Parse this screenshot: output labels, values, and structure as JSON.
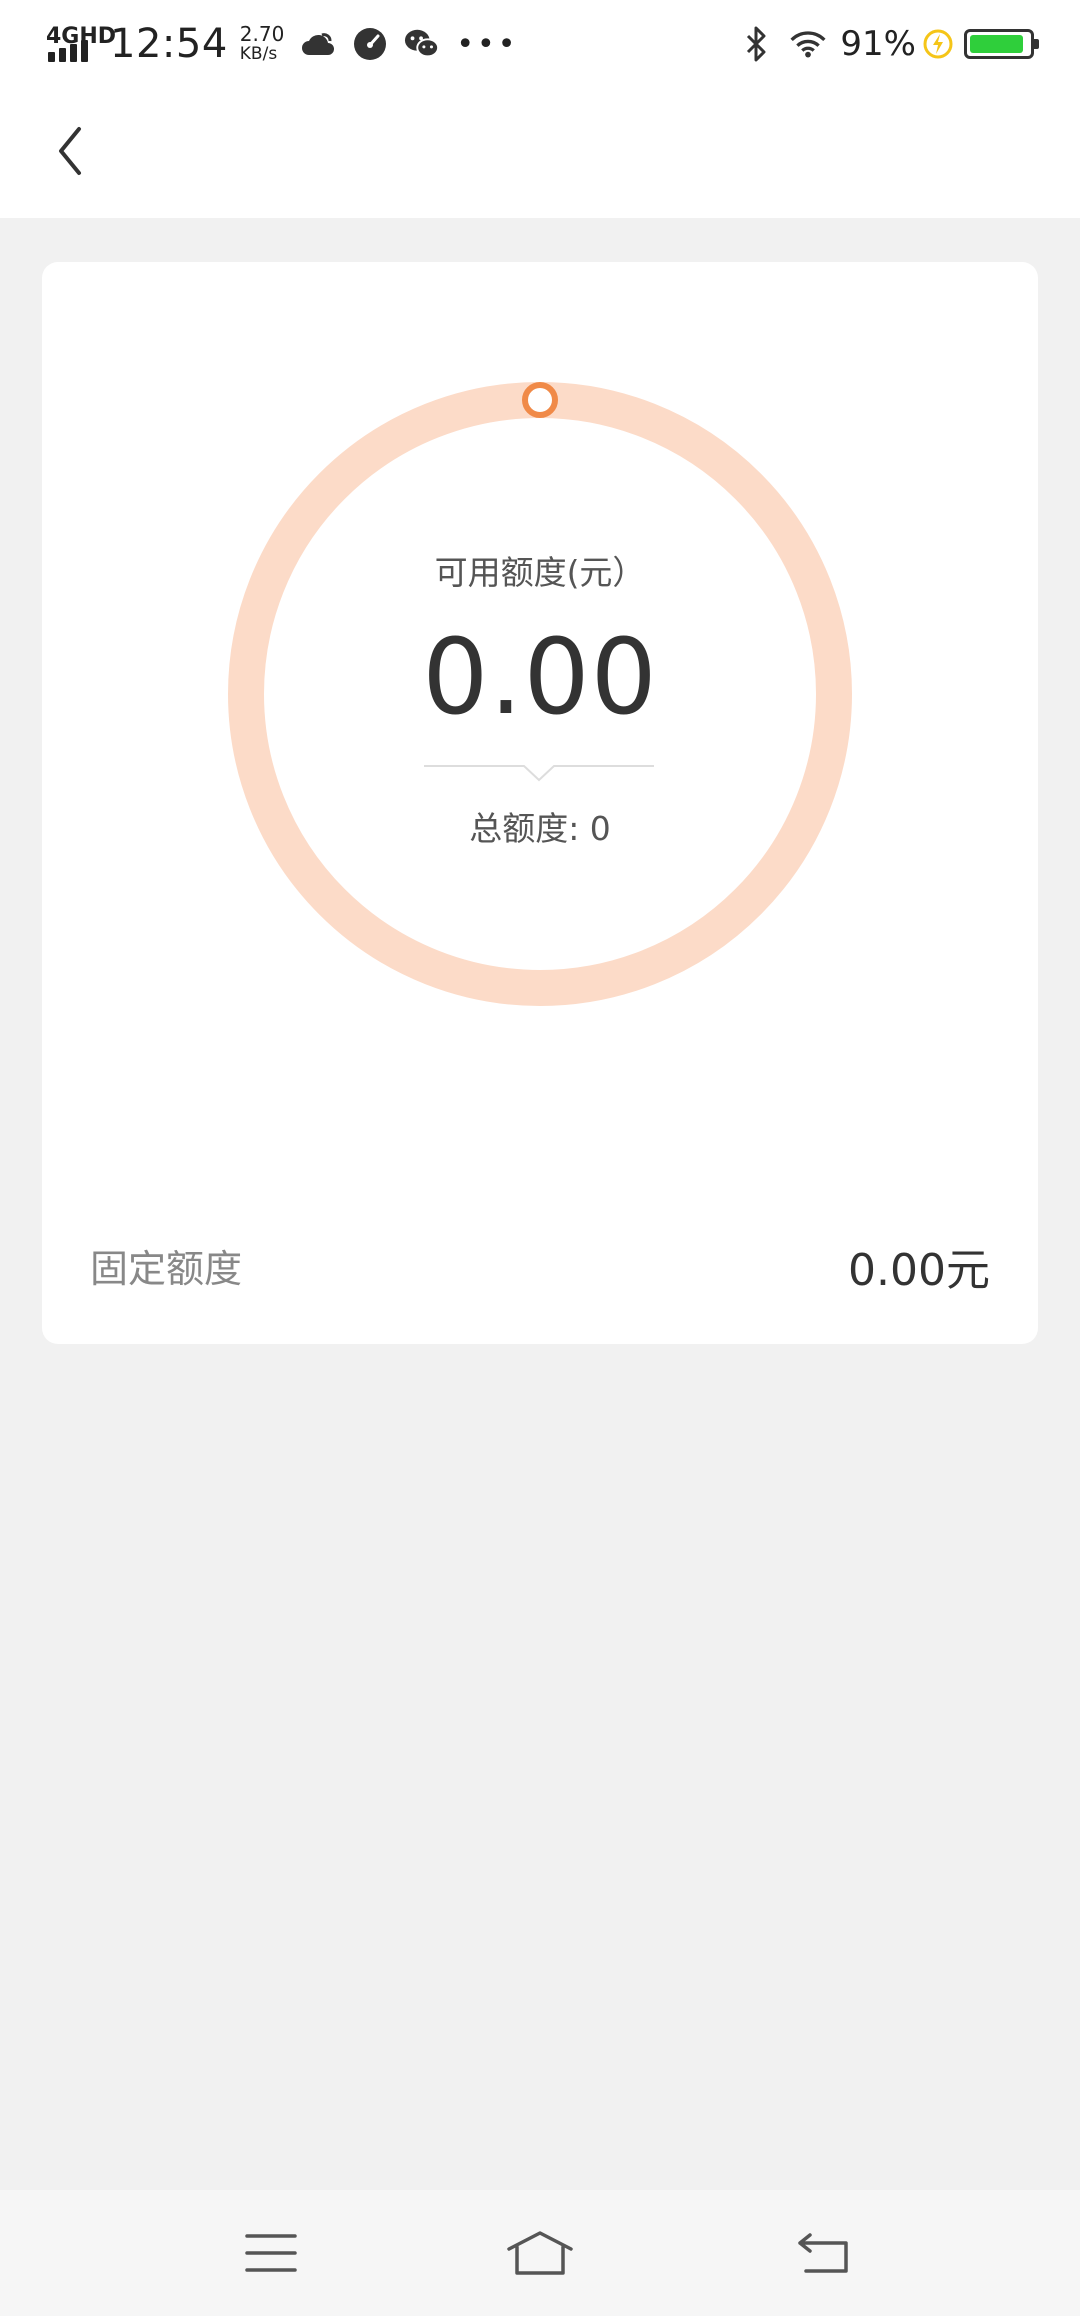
{
  "status_bar": {
    "network": "4GHD",
    "time": "12:54",
    "speed_value": "2.70",
    "speed_unit": "KB/s",
    "icons": [
      "weather-cloud-icon",
      "speedometer-icon",
      "wechat-icon",
      "more-dots-icon",
      "bluetooth-icon",
      "wifi-icon",
      "charging-icon",
      "battery-icon"
    ],
    "battery": "91%",
    "battery_level": 0.91
  },
  "nav": {
    "back_icon": "chevron-left-icon"
  },
  "credit_card": {
    "available_label": "可用额度(元）",
    "available_amount": "0.00",
    "total_label": "总额度: 0",
    "ring_progress": 0,
    "colors": {
      "ring_track": "#fcdbc8",
      "ring_marker": "#f08a48"
    },
    "fixed_label": "固定额度",
    "fixed_value": "0.00元"
  },
  "system_nav": {
    "icons": [
      "menu-icon",
      "home-icon",
      "back-icon"
    ]
  }
}
